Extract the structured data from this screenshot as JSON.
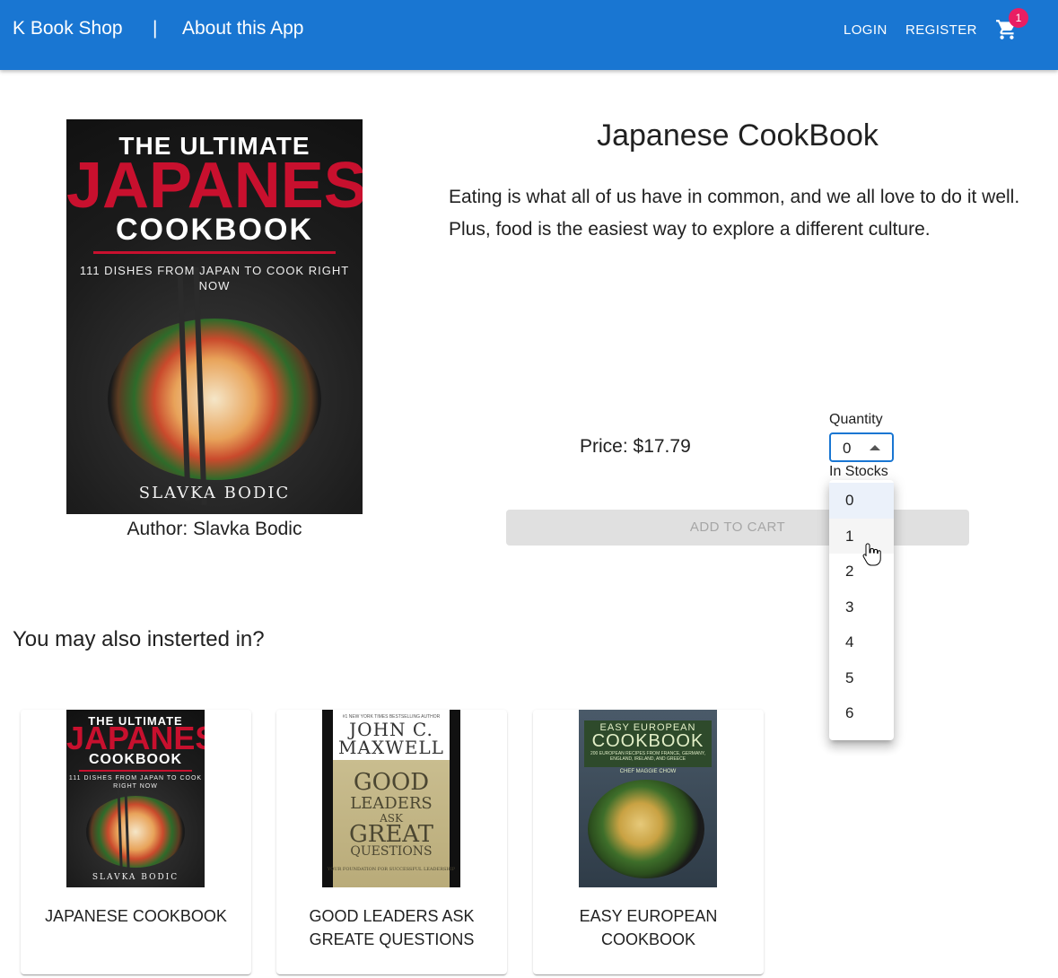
{
  "header": {
    "brand": "K Book Shop",
    "separator": "|",
    "about": "About this App",
    "login": "LOGIN",
    "register": "REGISTER",
    "cart_count": "1"
  },
  "product": {
    "title": "Japanese CookBook",
    "description": "Eating is what all of us have in common, and we all love to do it well. Plus, food is the easiest way to explore a different culture.",
    "author": "Author: Slavka Bodic",
    "price": "Price: $17.79",
    "quantity_label": "Quantity",
    "quantity_value": "0",
    "stock_label": "In Stocks",
    "add_to_cart": "ADD TO CART",
    "cover": {
      "line1": "THE ULTIMATE",
      "line2": "JAPANESE",
      "line3": "COOKBOOK",
      "line4": "111 DISHES FROM JAPAN TO COOK RIGHT NOW",
      "line5": "SLAVKA BODIC"
    }
  },
  "quantity_options": [
    "0",
    "1",
    "2",
    "3",
    "4",
    "5",
    "6"
  ],
  "recommend": {
    "heading": "You may also insterted in?",
    "items": [
      {
        "title": "JAPANESE COOKBOOK",
        "cover": {
          "line1": "THE ULTIMATE",
          "line2": "JAPANESE",
          "line3": "COOKBOOK",
          "line4": "111 DISHES FROM JAPAN TO COOK RIGHT NOW",
          "line5": "SLAVKA BODIC"
        }
      },
      {
        "title": "GOOD LEADERS ASK GREATE QUESTIONS",
        "cover": {
          "note": "#1 NEW YORK TIMES BESTSELLING AUTHOR",
          "name1": "JOHN C.",
          "name2": "MAXWELL",
          "w1": "GOOD",
          "w2": "LEADERS",
          "w3": "ASK",
          "w4": "GREAT",
          "w5": "QUESTIONS",
          "sub": "YOUR FOUNDATION FOR SUCCESSFUL LEADERSHIP"
        }
      },
      {
        "title": "EASY EUROPEAN COOKBOOK",
        "cover": {
          "line1": "EASY EUROPEAN",
          "line2": "COOKBOOK",
          "line3": "200 EUROPEAN RECIPES FROM FRANCE, GERMANY, ENGLAND, IRELAND, AND GREECE",
          "author": "CHEF MAGGIE CHOW"
        }
      }
    ]
  },
  "colors": {
    "app_bar": "#1976d2",
    "badge": "#e91e63",
    "disabled_button": "#e0e0e0"
  },
  "icons": {
    "cart": "shopping-cart-icon",
    "select_arrow": "arrow-drop-up-icon",
    "cursor": "hand-pointer-cursor"
  }
}
